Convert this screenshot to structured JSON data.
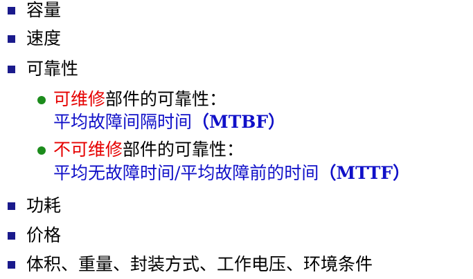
{
  "colors": {
    "bullet_square": "#1a1a8c",
    "bullet_dot": "#1c8c1c",
    "emphasis_red": "#e60000",
    "definition_blue": "#1010c8",
    "text": "#000000"
  },
  "items": [
    {
      "text": "容量"
    },
    {
      "text": "速度"
    },
    {
      "text": "可靠性"
    }
  ],
  "reliability_subitems": [
    {
      "highlight": "可维修",
      "rest": "部件的可靠性：",
      "definition": "平均故障间隔时间",
      "abbr": "（MTBF）"
    },
    {
      "highlight": "不可维修",
      "rest": "部件的可靠性：",
      "definition": "平均无故障时间/平均故障前的时间",
      "abbr": "（MTTF）"
    }
  ],
  "items_after": [
    {
      "text": "功耗"
    },
    {
      "text": "价格"
    },
    {
      "text": "体积、重量、封装方式、工作电压、环境条件"
    }
  ]
}
